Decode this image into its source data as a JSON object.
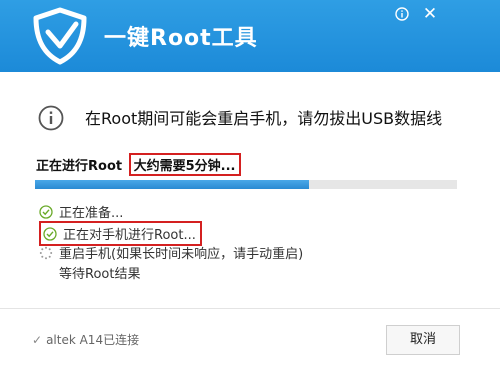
{
  "header": {
    "title": "一键Root工具",
    "info_icon": "info-icon",
    "close_icon": "close-icon",
    "brand_color": "#1c8ad8"
  },
  "notice": {
    "icon": "info-circle-icon",
    "text": "在Root期间可能会重启手机，请勿拔出USB数据线"
  },
  "status": {
    "label": "正在进行Root",
    "estimate": "大约需要5分钟..."
  },
  "progress": {
    "value": 0.65
  },
  "steps": [
    {
      "label": "正在准备...",
      "state": "done"
    },
    {
      "label": "正在对手机进行Root...",
      "state": "done"
    },
    {
      "label": "重启手机(如果长时间未响应，请手动重启)",
      "state": "pending"
    },
    {
      "label": "等待Root结果",
      "state": "pending"
    }
  ],
  "footer": {
    "device": "altek A14已连接",
    "cancel_label": "取消"
  }
}
